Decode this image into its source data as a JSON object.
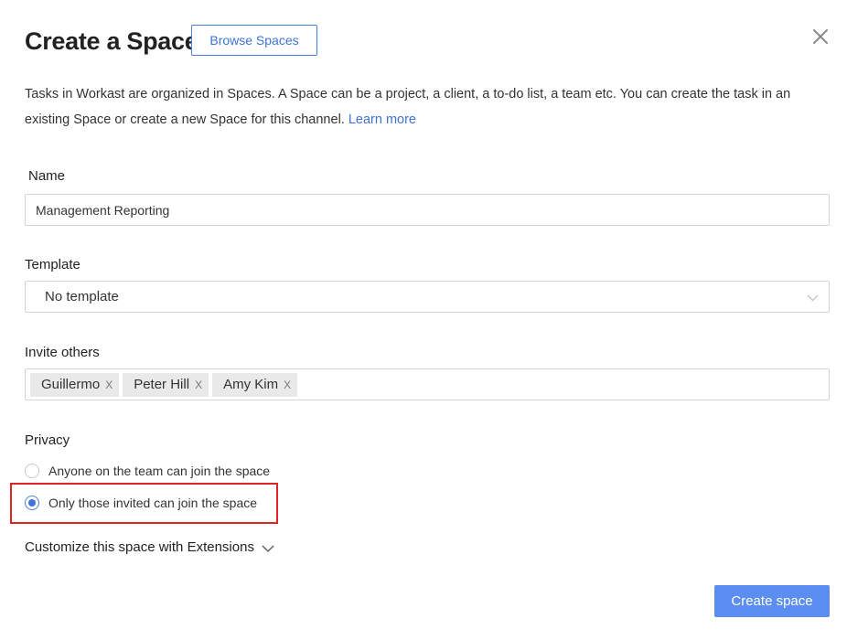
{
  "header": {
    "title": "Create a Space",
    "browse_label": "Browse Spaces"
  },
  "description": {
    "text": "Tasks in Workast are organized in Spaces. A Space can be a project, a client, a to-do list, a team etc. You can create the task in an existing Space or create a new Space for this channel. ",
    "link": "Learn more"
  },
  "name_field": {
    "label": "Name",
    "value": "Management Reporting"
  },
  "template_field": {
    "label": "Template",
    "selected": "No template"
  },
  "invite_field": {
    "label": "Invite others",
    "chips": [
      "Guillermo",
      "Peter Hill",
      "Amy Kim"
    ],
    "remove_glyph": "X"
  },
  "privacy": {
    "label": "Privacy",
    "options": [
      {
        "label": "Anyone on the team can join the space",
        "checked": false
      },
      {
        "label": "Only those invited can join the space",
        "checked": true
      }
    ]
  },
  "extensions": {
    "label": "Customize this space with Extensions"
  },
  "footer": {
    "create_label": "Create space"
  },
  "colors": {
    "accent": "#3f73d8",
    "primary_button": "#5b8ef0",
    "highlight_border": "#e02424"
  },
  "icons": {
    "close": "close-icon",
    "select_chevron": "chevron-down-icon",
    "extensions_chevron": "chevron-down-icon"
  }
}
